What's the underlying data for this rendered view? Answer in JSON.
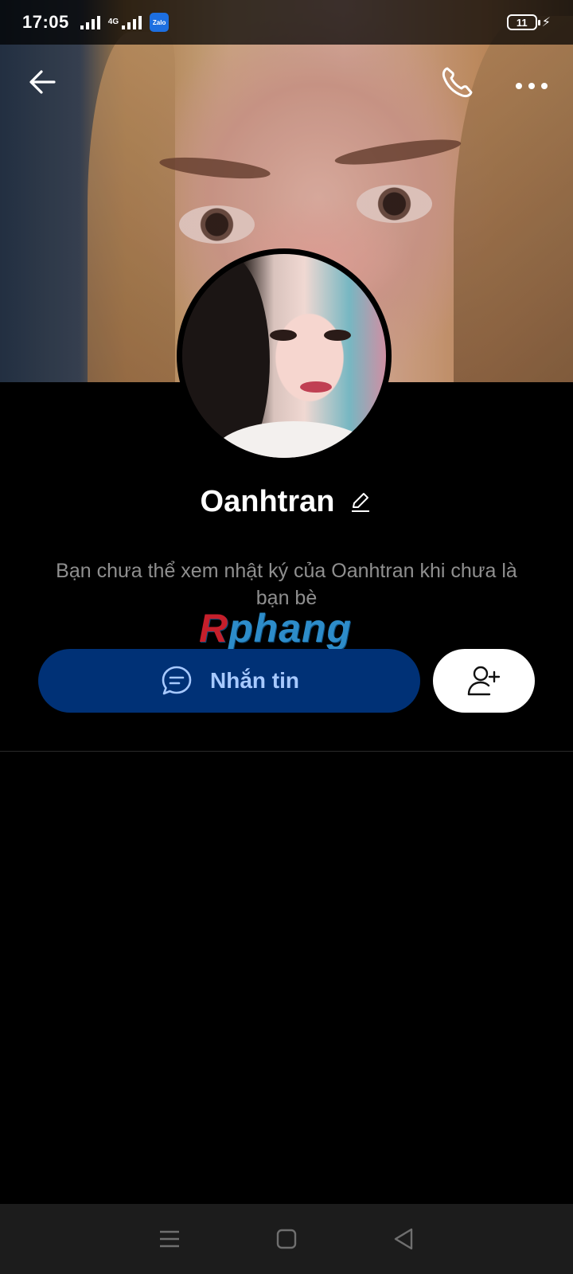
{
  "status_bar": {
    "time": "17:05",
    "network_tag": "4G",
    "app_badge": "Zalo",
    "battery_level": "11",
    "charging": true
  },
  "topbar": {
    "back_icon": "arrow-left-icon",
    "call_icon": "phone-icon",
    "more_icon": "more-dots-icon"
  },
  "profile": {
    "name": "Oanhtran",
    "notice": "Bạn chưa thể xem nhật ký của Oanhtran khi chưa là bạn bè"
  },
  "watermark": {
    "first_letter": "R",
    "rest": "phang"
  },
  "actions": {
    "message_label": "Nhắn tin",
    "add_friend_icon": "add-user-icon"
  },
  "colors": {
    "background": "#000000",
    "message_button": "#003176",
    "message_label": "#a7c9ff",
    "notice_text": "#8f8f8f"
  }
}
